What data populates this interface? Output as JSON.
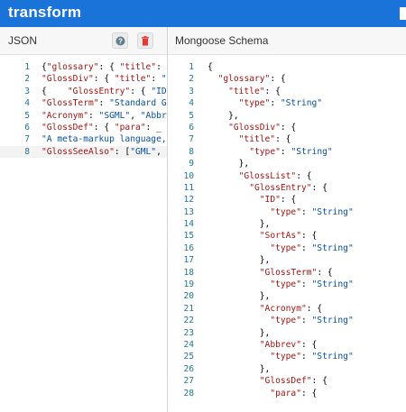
{
  "app": {
    "title": "transform"
  },
  "left_panel": {
    "title": "JSON",
    "help_icon": "help-circle-icon",
    "delete_icon": "trash-icon",
    "accent_help": "#607d8b",
    "accent_delete": "#e53935"
  },
  "right_panel": {
    "title": "Mongoose Schema"
  },
  "json_lines": [
    {
      "n": "1",
      "t": "{\"glossary\": { \"title\": \""
    },
    {
      "n": "2",
      "t": "\"GlossDiv\": { \"title\": \"S"
    },
    {
      "n": "3",
      "t": "{    \"GlossEntry\": { \"ID\""
    },
    {
      "n": "4",
      "t": "\"GlossTerm\": \"Standard G"
    },
    {
      "n": "5",
      "t": "\"Acronym\": \"SGML\", \"Abbr"
    },
    {
      "n": "6",
      "t": "\"GlossDef\": { \"para\": _"
    },
    {
      "n": "7",
      "t": "\"A meta-markup language,"
    },
    {
      "n": "8",
      "t": "\"GlossSeeAlso\": [\"GML\","
    }
  ],
  "schema_lines": [
    {
      "n": "1",
      "t": "{"
    },
    {
      "n": "2",
      "t": "  \"glossary\": {"
    },
    {
      "n": "3",
      "t": "    \"title\": {"
    },
    {
      "n": "4",
      "t": "      \"type\": \"String\""
    },
    {
      "n": "5",
      "t": "    },"
    },
    {
      "n": "6",
      "t": "    \"GlossDiv\": {"
    },
    {
      "n": "7",
      "t": "      \"title\": {"
    },
    {
      "n": "8",
      "t": "        \"type\": \"String\""
    },
    {
      "n": "9",
      "t": "      },"
    },
    {
      "n": "10",
      "t": "      \"GlossList\": {"
    },
    {
      "n": "11",
      "t": "        \"GlossEntry\": {"
    },
    {
      "n": "12",
      "t": "          \"ID\": {"
    },
    {
      "n": "13",
      "t": "            \"type\": \"String\""
    },
    {
      "n": "14",
      "t": "          },"
    },
    {
      "n": "15",
      "t": "          \"SortAs\": {"
    },
    {
      "n": "16",
      "t": "            \"type\": \"String\""
    },
    {
      "n": "17",
      "t": "          },"
    },
    {
      "n": "18",
      "t": "          \"GlossTerm\": {"
    },
    {
      "n": "19",
      "t": "            \"type\": \"String\""
    },
    {
      "n": "20",
      "t": "          },"
    },
    {
      "n": "21",
      "t": "          \"Acronym\": {"
    },
    {
      "n": "22",
      "t": "            \"type\": \"String\""
    },
    {
      "n": "23",
      "t": "          },"
    },
    {
      "n": "24",
      "t": "          \"Abbrev\": {"
    },
    {
      "n": "25",
      "t": "            \"type\": \"String\""
    },
    {
      "n": "26",
      "t": "          },"
    },
    {
      "n": "27",
      "t": "          \"GlossDef\": {"
    },
    {
      "n": "28",
      "t": "            \"para\": {"
    }
  ]
}
